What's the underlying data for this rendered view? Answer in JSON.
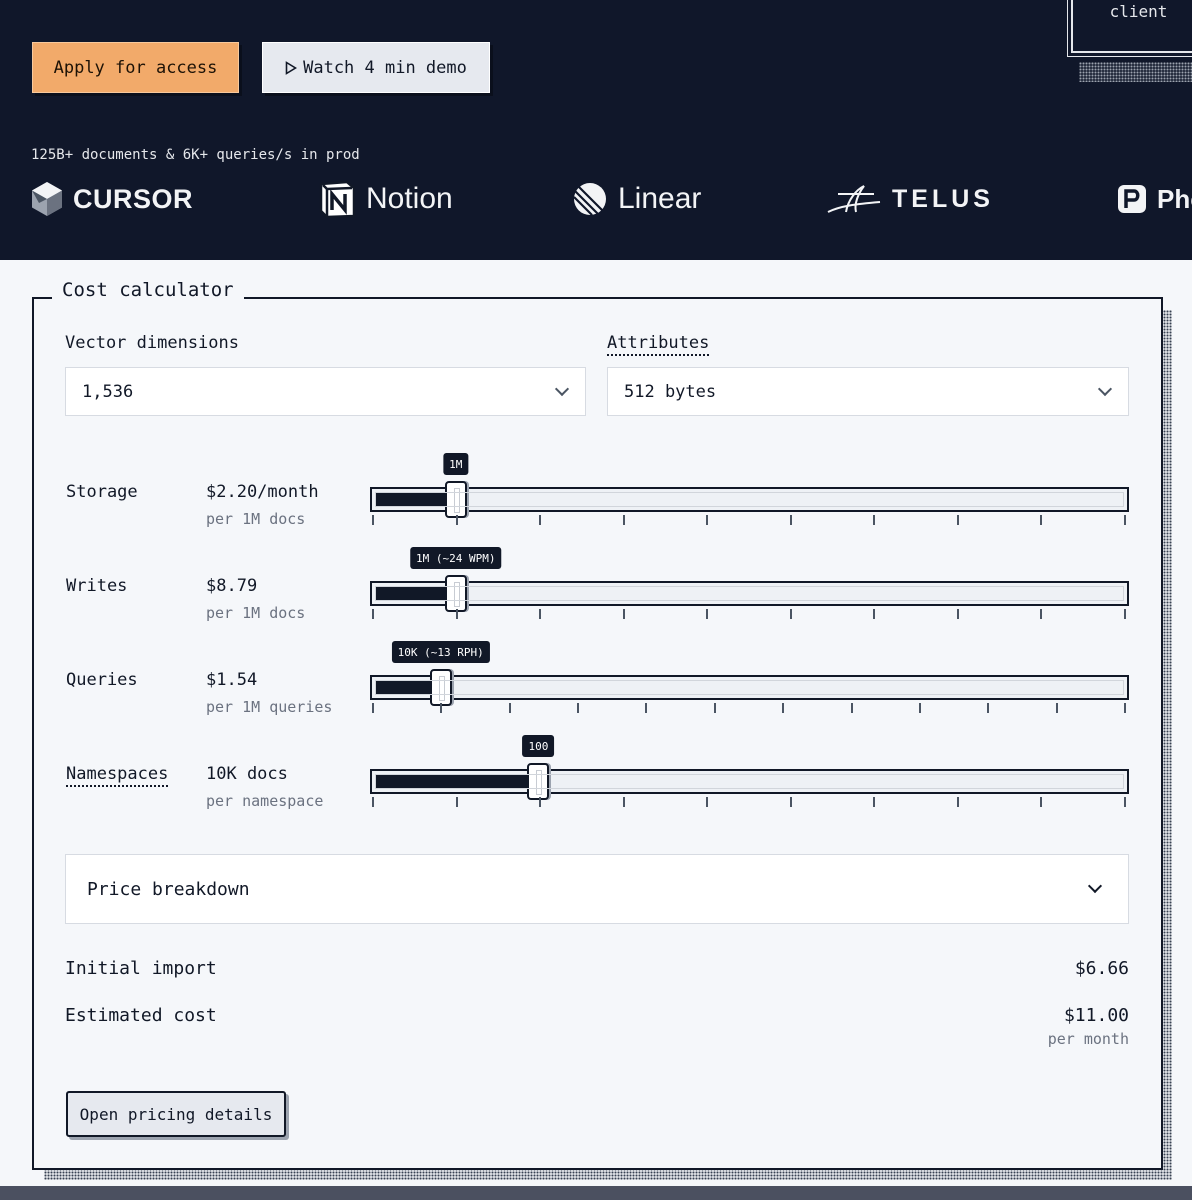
{
  "header": {
    "apply_label": "Apply for access",
    "demo_label": "Watch 4 min demo",
    "demo_icon": "play-icon",
    "client_label": "client",
    "tagline": "125B+ documents & 6K+ queries/s in prod",
    "logos": [
      {
        "name": "CURSOR"
      },
      {
        "name": "Notion"
      },
      {
        "name": "Linear"
      },
      {
        "name": "TELUS"
      },
      {
        "name": "Pho"
      }
    ]
  },
  "calculator": {
    "title": "Cost calculator",
    "vector_dimensions": {
      "label": "Vector dimensions",
      "value": "1,536"
    },
    "attributes": {
      "label": "Attributes",
      "value": "512 bytes"
    },
    "rows": [
      {
        "name": "Storage",
        "price": "$2.20/month",
        "unit": "per 1M docs",
        "tooltip": "1M",
        "fraction": 0.11,
        "ticks": 10
      },
      {
        "name": "Writes",
        "price": "$8.79",
        "unit": "per 1M docs",
        "tooltip": "1M (~24 WPM)",
        "fraction": 0.11,
        "ticks": 10
      },
      {
        "name": "Queries",
        "price": "$1.54",
        "unit": "per 1M queries",
        "tooltip": "10K (~13 RPH)",
        "fraction": 0.09,
        "ticks": 12
      },
      {
        "name": "Namespaces",
        "price": "10K docs",
        "unit": "per namespace",
        "tooltip": "100",
        "fraction": 0.22,
        "ticks": 10
      }
    ],
    "breakdown_label": "Price breakdown",
    "initial_import": {
      "label": "Initial import",
      "value": "$6.66"
    },
    "estimated_cost": {
      "label": "Estimated cost",
      "value": "$11.00",
      "sub": "per month"
    },
    "open_pricing_label": "Open pricing details"
  },
  "colors": {
    "hero_bg": "#10172a",
    "accent": "#f2aa6a",
    "ink": "#111827"
  }
}
